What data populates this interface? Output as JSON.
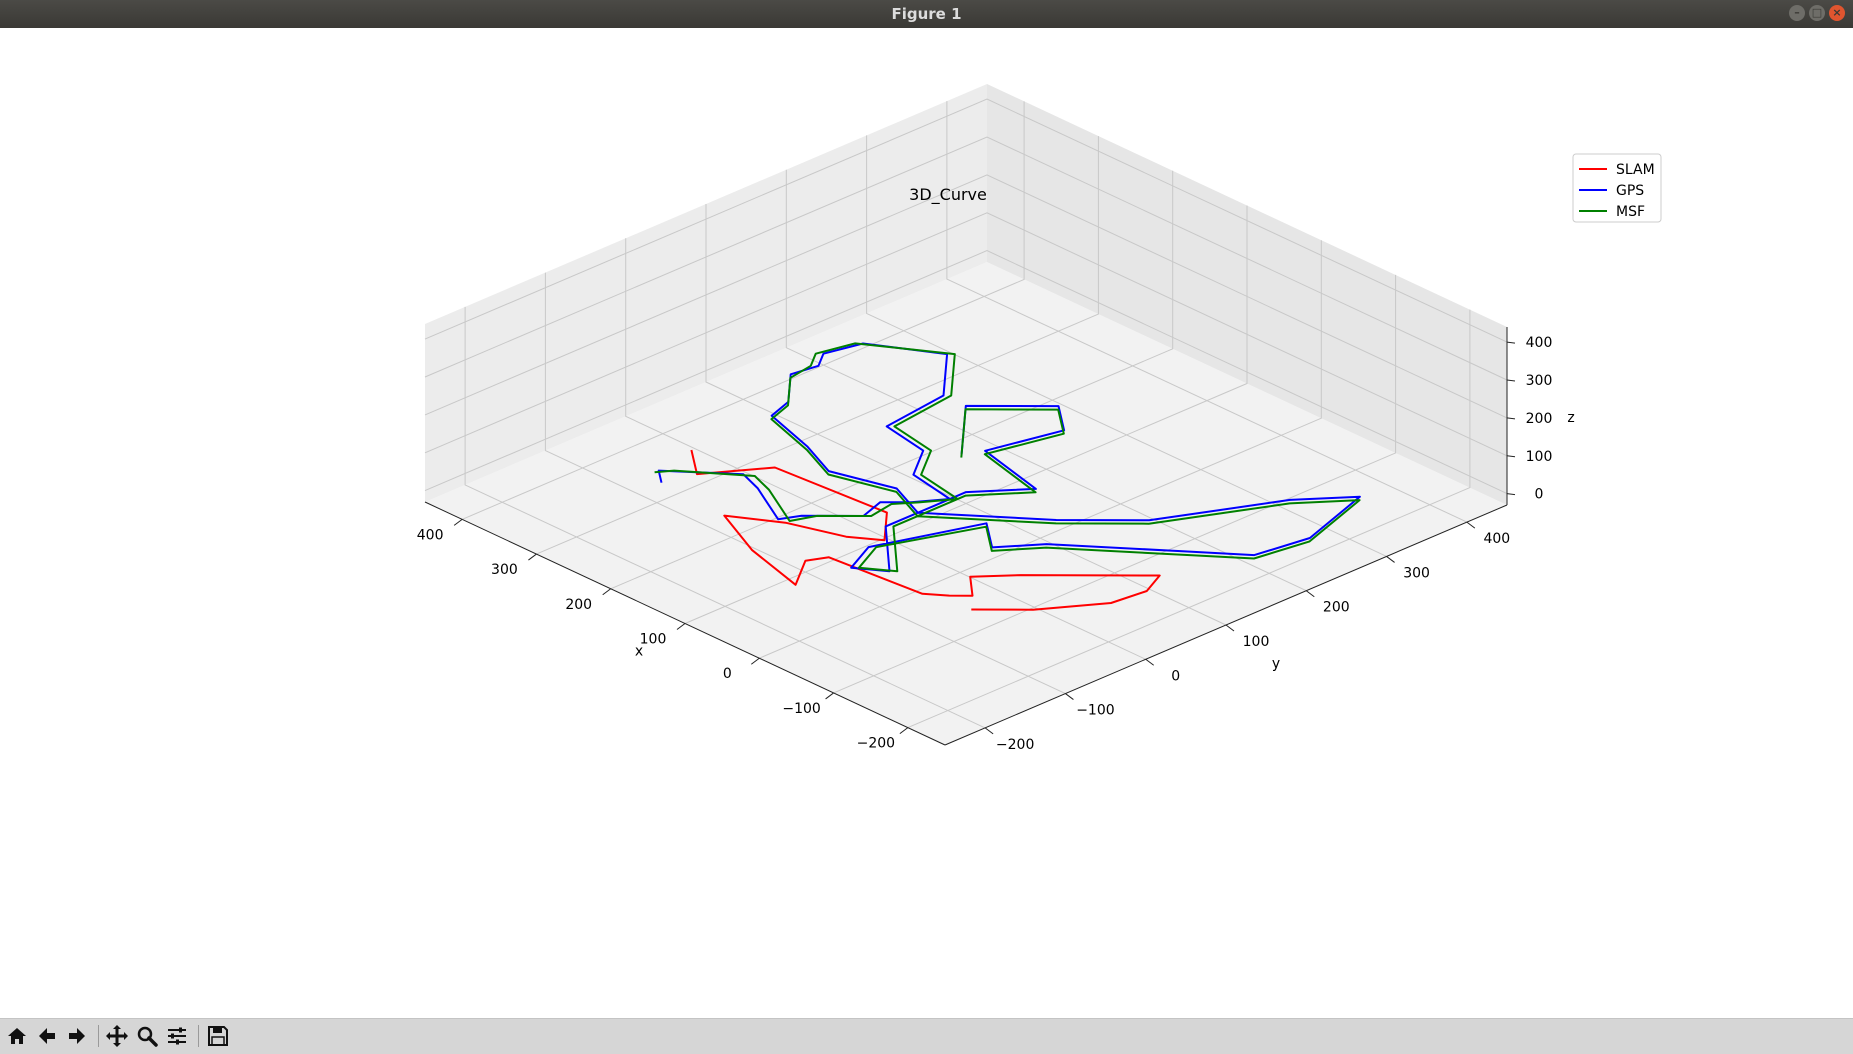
{
  "window": {
    "title": "Figure 1"
  },
  "toolbar": {
    "buttons": [
      {
        "name": "home-button",
        "icon": "home-icon"
      },
      {
        "name": "back-button",
        "icon": "arrow-left-icon"
      },
      {
        "name": "forward-button",
        "icon": "arrow-right-icon"
      },
      {
        "name": "pan-button",
        "icon": "move-icon"
      },
      {
        "name": "zoom-button",
        "icon": "magnifier-icon"
      },
      {
        "name": "configure-subplots-button",
        "icon": "sliders-icon"
      },
      {
        "name": "save-button",
        "icon": "floppy-icon"
      }
    ]
  },
  "chart_data": {
    "type": "line",
    "projection": "3d",
    "title": "3D_Curve",
    "xlabel": "x",
    "ylabel": "y",
    "zlabel": "z",
    "xlim": [
      -250,
      450
    ],
    "ylim": [
      -250,
      450
    ],
    "zlim": [
      -30,
      440
    ],
    "xticks": [
      -200,
      -100,
      0,
      100,
      200,
      300,
      400
    ],
    "yticks": [
      -200,
      -100,
      0,
      100,
      200,
      300,
      400
    ],
    "zticks": [
      0,
      100,
      200,
      300,
      400
    ],
    "xtick_labels": [
      "−200",
      "−100",
      "0",
      "100",
      "200",
      "300",
      "400"
    ],
    "ytick_labels": [
      "−200",
      "−100",
      "0",
      "100",
      "200",
      "300",
      "400"
    ],
    "ztick_labels": [
      "0",
      "100",
      "200",
      "300",
      "400"
    ],
    "grid": true,
    "legend": {
      "placement": "top-right",
      "entries": [
        "SLAM",
        "GPS",
        "MSF"
      ]
    },
    "series": [
      {
        "name": "SLAM",
        "color": "#ff0000",
        "points": [
          [
            -80,
            -60,
            0
          ],
          [
            -120,
            -20,
            0
          ],
          [
            -160,
            40,
            0
          ],
          [
            -165,
            80,
            0
          ],
          [
            -150,
            110,
            0
          ],
          [
            -60,
            20,
            0
          ],
          [
            -30,
            -15,
            0
          ],
          [
            -60,
            -40,
            0
          ],
          [
            -45,
            -55,
            0
          ],
          [
            -25,
            -70,
            0
          ],
          [
            90,
            -80,
            0
          ],
          [
            100,
            -100,
            0
          ],
          [
            70,
            -140,
            0
          ],
          [
            150,
            -120,
            0
          ],
          [
            220,
            -90,
            0
          ],
          [
            170,
            -60,
            0
          ],
          [
            110,
            -40,
            0
          ],
          [
            80,
            -20,
            0
          ],
          [
            120,
            20,
            0
          ],
          [
            260,
            10,
            0
          ],
          [
            300,
            -50,
            0
          ],
          [
            340,
            -20,
            0
          ]
        ]
      },
      {
        "name": "GPS",
        "color": "#0000ff",
        "points": [
          [
            310,
            -85,
            0
          ],
          [
            330,
            -70,
            0
          ],
          [
            270,
            -20,
            0
          ],
          [
            240,
            -30,
            0
          ],
          [
            180,
            -60,
            0
          ],
          [
            170,
            -40,
            0
          ],
          [
            130,
            0,
            0
          ],
          [
            140,
            30,
            0
          ],
          [
            120,
            50,
            0
          ],
          [
            100,
            80,
            0
          ],
          [
            160,
            90,
            0
          ],
          [
            190,
            130,
            0
          ],
          [
            250,
            140,
            0
          ],
          [
            260,
            220,
            0
          ],
          [
            320,
            280,
            0
          ],
          [
            390,
            240,
            0
          ],
          [
            400,
            200,
            0
          ],
          [
            385,
            180,
            0
          ],
          [
            390,
            150,
            0
          ],
          [
            350,
            110,
            0
          ],
          [
            340,
            80,
            0
          ],
          [
            270,
            60,
            0
          ],
          [
            220,
            40,
            0
          ],
          [
            150,
            60,
            0
          ],
          [
            100,
            40,
            0
          ],
          [
            0,
            120,
            0
          ],
          [
            -60,
            180,
            0
          ],
          [
            -120,
            300,
            0
          ],
          [
            -160,
            350,
            0
          ],
          [
            -190,
            260,
            0
          ],
          [
            -180,
            200,
            0
          ],
          [
            -130,
            160,
            0
          ],
          [
            -30,
            80,
            0
          ],
          [
            0,
            40,
            0
          ],
          [
            40,
            70,
            0
          ],
          [
            80,
            -40,
            0
          ],
          [
            60,
            -80,
            0
          ],
          [
            30,
            -60,
            0
          ],
          [
            100,
            0,
            0
          ],
          [
            100,
            60,
            0
          ],
          [
            100,
            100,
            0
          ],
          [
            60,
            150,
            0
          ],
          [
            150,
            170,
            0
          ],
          [
            130,
            250,
            0
          ],
          [
            170,
            280,
            0
          ],
          [
            230,
            220,
            0
          ],
          [
            190,
            180,
            0
          ],
          [
            160,
            150,
            0
          ]
        ]
      },
      {
        "name": "MSF",
        "color": "#008000",
        "points": [
          [
            330,
            -75,
            0
          ],
          [
            320,
            -60,
            0
          ],
          [
            260,
            -15,
            0
          ],
          [
            230,
            -25,
            0
          ],
          [
            170,
            -55,
            0
          ],
          [
            160,
            -30,
            0
          ],
          [
            125,
            5,
            0
          ],
          [
            130,
            35,
            0
          ],
          [
            115,
            55,
            0
          ],
          [
            95,
            85,
            0
          ],
          [
            155,
            95,
            0
          ],
          [
            185,
            135,
            0
          ],
          [
            245,
            145,
            0
          ],
          [
            255,
            225,
            0
          ],
          [
            315,
            285,
            0
          ],
          [
            395,
            235,
            0
          ],
          [
            405,
            195,
            0
          ],
          [
            390,
            175,
            0
          ],
          [
            385,
            145,
            0
          ],
          [
            345,
            105,
            0
          ],
          [
            335,
            75,
            0
          ],
          [
            265,
            55,
            0
          ],
          [
            215,
            35,
            0
          ],
          [
            145,
            55,
            0
          ],
          [
            95,
            35,
            0
          ],
          [
            -5,
            115,
            0
          ],
          [
            -65,
            175,
            0
          ],
          [
            -125,
            295,
            0
          ],
          [
            -165,
            345,
            0
          ],
          [
            -195,
            255,
            0
          ],
          [
            -185,
            195,
            0
          ],
          [
            -135,
            155,
            0
          ],
          [
            -35,
            75,
            0
          ],
          [
            -5,
            35,
            0
          ],
          [
            35,
            65,
            0
          ],
          [
            75,
            -35,
            0
          ],
          [
            55,
            -75,
            0
          ],
          [
            25,
            -55,
            0
          ],
          [
            95,
            5,
            0
          ],
          [
            95,
            55,
            0
          ],
          [
            95,
            95,
            0
          ],
          [
            55,
            145,
            0
          ],
          [
            145,
            165,
            0
          ],
          [
            125,
            245,
            0
          ],
          [
            165,
            275,
            0
          ],
          [
            225,
            215,
            0
          ],
          [
            185,
            175,
            0
          ],
          [
            155,
            145,
            0
          ]
        ]
      }
    ]
  }
}
